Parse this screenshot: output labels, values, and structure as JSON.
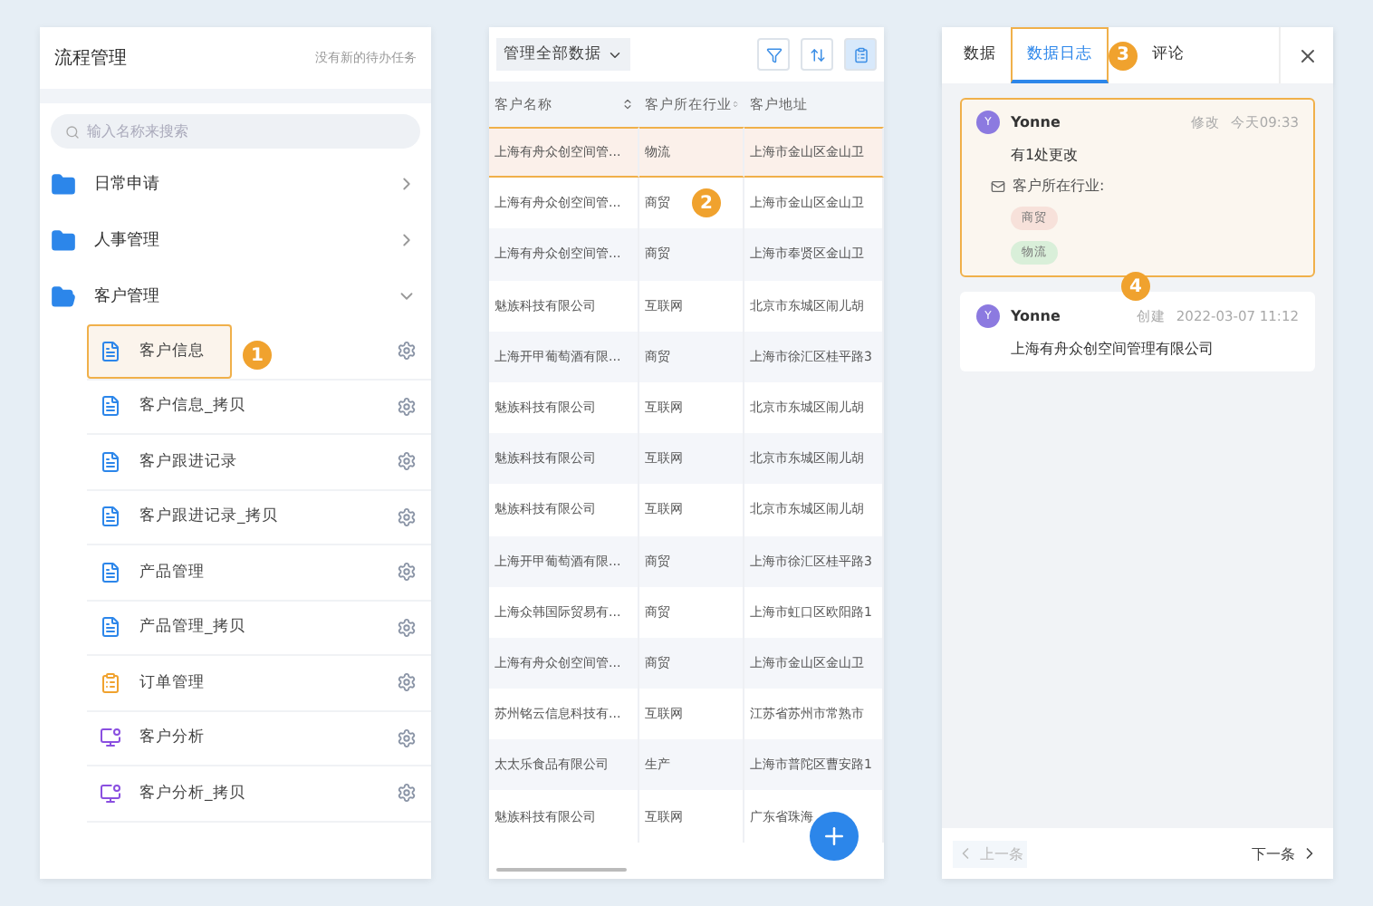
{
  "flow_panel": {
    "title": "流程管理",
    "notice": "没有新的待办任务",
    "search": {
      "placeholder": "输入名称来搜索"
    },
    "folders": [
      {
        "label": "日常申请",
        "expanded": false
      },
      {
        "label": "人事管理",
        "expanded": false
      },
      {
        "label": "客户管理",
        "expanded": true,
        "children": [
          {
            "label": "客户信息",
            "kind": "form",
            "selected": true,
            "badge": "1"
          },
          {
            "label": "客户信息_拷贝",
            "kind": "form",
            "selected": false
          },
          {
            "label": "客户跟进记录",
            "kind": "form",
            "selected": false
          },
          {
            "label": "客户跟进记录_拷贝",
            "kind": "form",
            "selected": false
          },
          {
            "label": "产品管理",
            "kind": "form",
            "selected": false
          },
          {
            "label": "产品管理_拷贝",
            "kind": "form",
            "selected": false
          },
          {
            "label": "订单管理",
            "kind": "flow",
            "selected": false
          },
          {
            "label": "客户分析",
            "kind": "report",
            "selected": false
          },
          {
            "label": "客户分析_拷贝",
            "kind": "report",
            "selected": false
          }
        ]
      }
    ]
  },
  "table_panel": {
    "scope": "管理全部数据",
    "columns": [
      "客户名称",
      "客户所在行业",
      "客户地址"
    ],
    "badge": "2",
    "rows": [
      {
        "cells": [
          "上海有舟众创空间管...",
          "物流",
          "上海市金山区金山卫"
        ],
        "selected": true
      },
      {
        "cells": [
          "上海有舟众创空间管...",
          "商贸",
          "上海市金山区金山卫"
        ],
        "selected": false
      },
      {
        "cells": [
          "上海有舟众创空间管...",
          "商贸",
          "上海市奉贤区金山卫"
        ],
        "selected": false
      },
      {
        "cells": [
          "魅族科技有限公司",
          "互联网",
          "北京市东城区闹儿胡"
        ],
        "selected": false
      },
      {
        "cells": [
          "上海开甲葡萄酒有限...",
          "商贸",
          "上海市徐汇区桂平路3"
        ],
        "selected": false
      },
      {
        "cells": [
          "魅族科技有限公司",
          "互联网",
          "北京市东城区闹儿胡"
        ],
        "selected": false
      },
      {
        "cells": [
          "魅族科技有限公司",
          "互联网",
          "北京市东城区闹儿胡"
        ],
        "selected": false
      },
      {
        "cells": [
          "魅族科技有限公司",
          "互联网",
          "北京市东城区闹儿胡"
        ],
        "selected": false
      },
      {
        "cells": [
          "上海开甲葡萄酒有限...",
          "商贸",
          "上海市徐汇区桂平路3"
        ],
        "selected": false
      },
      {
        "cells": [
          "上海众韩国际贸易有...",
          "商贸",
          "上海市虹口区欧阳路1"
        ],
        "selected": false
      },
      {
        "cells": [
          "上海有舟众创空间管...",
          "商贸",
          "上海市金山区金山卫"
        ],
        "selected": false
      },
      {
        "cells": [
          "苏州铭云信息科技有...",
          "互联网",
          "江苏省苏州市常熟市"
        ],
        "selected": false
      },
      {
        "cells": [
          "太太乐食品有限公司",
          "生产",
          "上海市普陀区曹安路1"
        ],
        "selected": false
      },
      {
        "cells": [
          "魅族科技有限公司",
          "互联网",
          "广东省珠海"
        ],
        "selected": false
      }
    ]
  },
  "detail_panel": {
    "tabs": [
      {
        "label": "数据",
        "selected": false
      },
      {
        "label": "数据日志",
        "selected": true
      },
      {
        "label": "评论",
        "selected": false
      }
    ],
    "tab_badge": "3",
    "card_badge": "4",
    "log": [
      {
        "avatar": "Y",
        "user": "Yonne",
        "action": "修改",
        "time": "今天09:33",
        "highlighted": true,
        "summary": "有1处更改",
        "field": "客户所在行业:",
        "old": "商贸",
        "new": "物流"
      },
      {
        "avatar": "Y",
        "user": "Yonne",
        "action": "创建",
        "time": "2022-03-07 11:12",
        "highlighted": false,
        "summary": "上海有舟众创空间管理有限公司"
      }
    ],
    "prev": {
      "label": "上一条",
      "disabled": true
    },
    "next": {
      "label": "下一条",
      "disabled": false
    }
  }
}
